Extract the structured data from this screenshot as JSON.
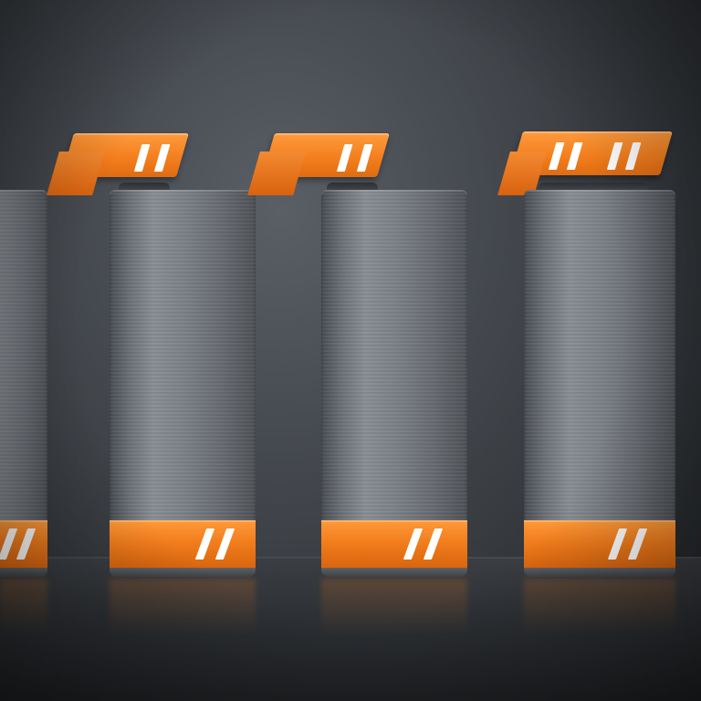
{
  "scene": {
    "description_label": "",
    "colors": {
      "accent": "#f27e1d",
      "casing": "#7c8187",
      "background": "#3f4348"
    },
    "items": [
      {
        "name": "battery-1",
        "band_stripes": 2,
        "lid_stripes": 0,
        "partial": true
      },
      {
        "name": "battery-2",
        "band_stripes": 2,
        "lid_stripes": 2,
        "partial": false
      },
      {
        "name": "battery-3",
        "band_stripes": 2,
        "lid_stripes": 2,
        "partial": false
      },
      {
        "name": "battery-4",
        "band_stripes": 2,
        "lid_stripes": 4,
        "partial": false
      }
    ]
  }
}
